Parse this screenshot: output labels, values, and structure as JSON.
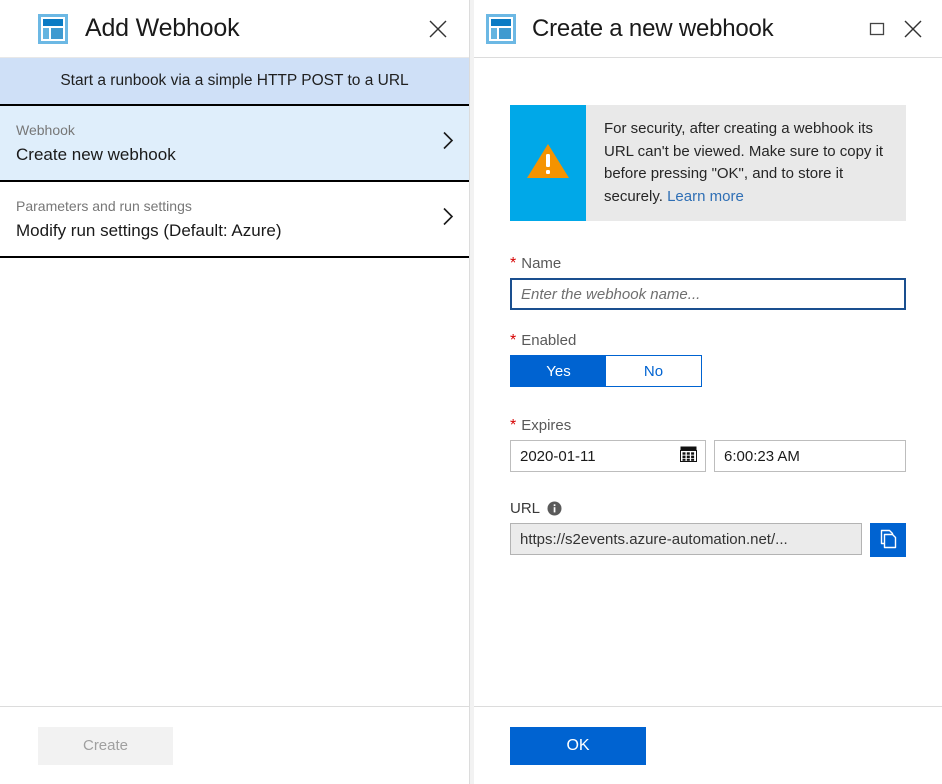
{
  "left_blade": {
    "icon": "blade-icon",
    "title": "Add Webhook",
    "close_label": "close-icon",
    "subtitle": "Start a runbook via a simple HTTP POST to a URL",
    "options": [
      {
        "label": "Webhook",
        "value": "Create new webhook",
        "chevron": "chevron-right-icon"
      },
      {
        "label": "Parameters and run settings",
        "value": "Modify run settings (Default: Azure)",
        "chevron": "chevron-right-icon"
      }
    ],
    "footer": {
      "create_label": "Create",
      "create_disabled": true
    }
  },
  "right_blade": {
    "icon": "blade-icon",
    "title": "Create a new webhook",
    "maximize_label": "maximize-icon",
    "close_label": "close-icon",
    "notice": {
      "icon": "warning-triangle-icon",
      "text": "For security, after creating a webhook its URL can't be viewed. Make sure to copy it before pressing \"OK\", and to store it securely. ",
      "link_text": "Learn more"
    },
    "fields": {
      "name": {
        "label": "Name",
        "required_marker": "*",
        "value": "",
        "placeholder": "Enter the webhook name..."
      },
      "enabled": {
        "label": "Enabled",
        "required_marker": "*",
        "options": [
          "Yes",
          "No"
        ],
        "selected": "Yes"
      },
      "expires": {
        "label": "Expires",
        "required_marker": "*",
        "date_value": "2020-01-11",
        "date_icon": "calendar-icon",
        "time_value": "6:00:23 AM"
      },
      "url": {
        "label": "URL",
        "info_icon": "info-icon",
        "value": "https://s2events.azure-automation.net/...",
        "copy_icon": "copy-icon"
      }
    },
    "footer": {
      "ok_label": "OK"
    }
  },
  "colors": {
    "accent_blue": "#0063d1",
    "subtitle_bar": "#cfe0f7",
    "selected_row": "#dfeefb",
    "notice_strip": "#00a8e8",
    "warning_orange": "#f59300",
    "required_red": "#d60000",
    "link_blue": "#2f6fb5"
  }
}
